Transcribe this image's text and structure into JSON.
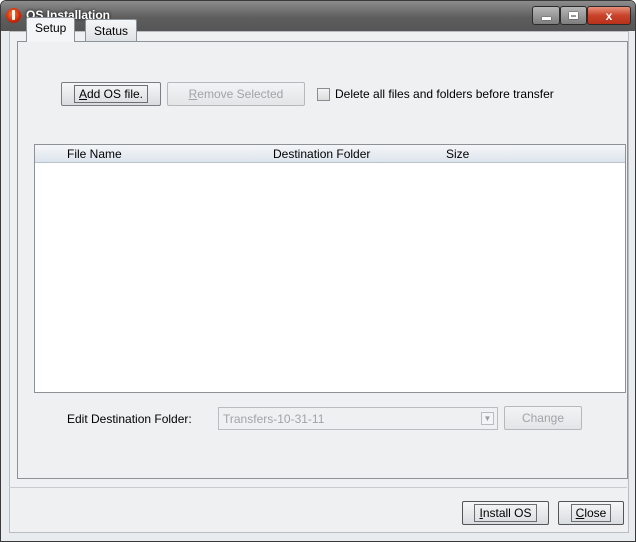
{
  "window": {
    "title": "OS Installation",
    "controls": {
      "minimize": "minimize",
      "maximize": "maximize",
      "close_glyph": "x"
    }
  },
  "tabs": [
    {
      "label": "Setup",
      "active": true
    },
    {
      "label": "Status",
      "active": false
    }
  ],
  "toolbar": {
    "add_mnemonic": "A",
    "add_rest": "dd OS file.",
    "remove_mnemonic": "R",
    "remove_rest": "emove Selected",
    "delete_all_label": "Delete all files and folders before transfer",
    "delete_all_checked": false
  },
  "table": {
    "columns": [
      "File Name",
      "Destination Folder",
      "Size"
    ],
    "rows": []
  },
  "destination": {
    "label": "Edit Destination Folder:",
    "value": "Transfers-10-31-11",
    "change_label": "Change"
  },
  "footer": {
    "install_mnemonic": "I",
    "install_rest": "nstall OS",
    "close_mnemonic": "C",
    "close_rest": "lose"
  },
  "icons": {
    "app": "ti-connect-icon",
    "dropdown": "chevron-down-icon"
  },
  "colors": {
    "title_bar": "#5e5e5e",
    "close_button": "#c9432a",
    "panel_bg": "#eef0f2"
  }
}
